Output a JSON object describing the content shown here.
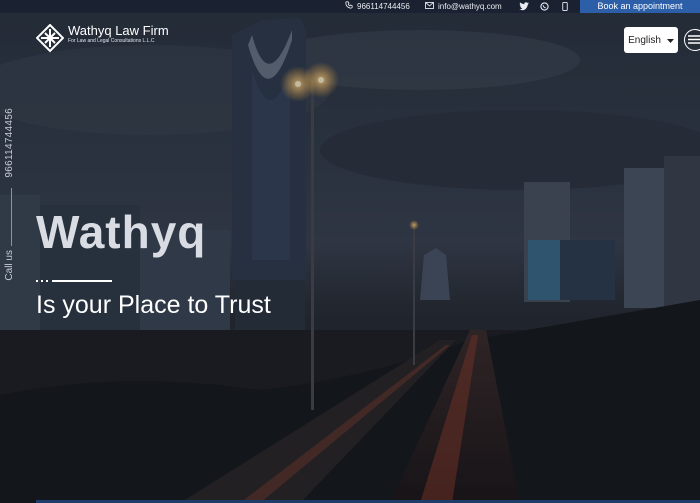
{
  "topbar": {
    "phone": "966114744456",
    "email": "info@wathyq.com",
    "book_label": "Book an appointment"
  },
  "logo": {
    "title": "Wathyq Law Firm",
    "subtitle": "For Law and Legal Consultations L.L.C"
  },
  "language": {
    "selected": "English"
  },
  "sidebar": {
    "phone": "966114744456",
    "call_label": "Call us"
  },
  "hero": {
    "title": "Wathyq",
    "tagline": "Is your Place to Trust"
  },
  "colors": {
    "accent": "#2c5fa8",
    "title": "#d9dde3"
  },
  "icons": [
    "phone-icon",
    "mail-icon",
    "twitter-icon",
    "whatsapp-icon",
    "mobile-icon",
    "chevron-down-icon",
    "menu-icon",
    "logo-mark-icon"
  ]
}
